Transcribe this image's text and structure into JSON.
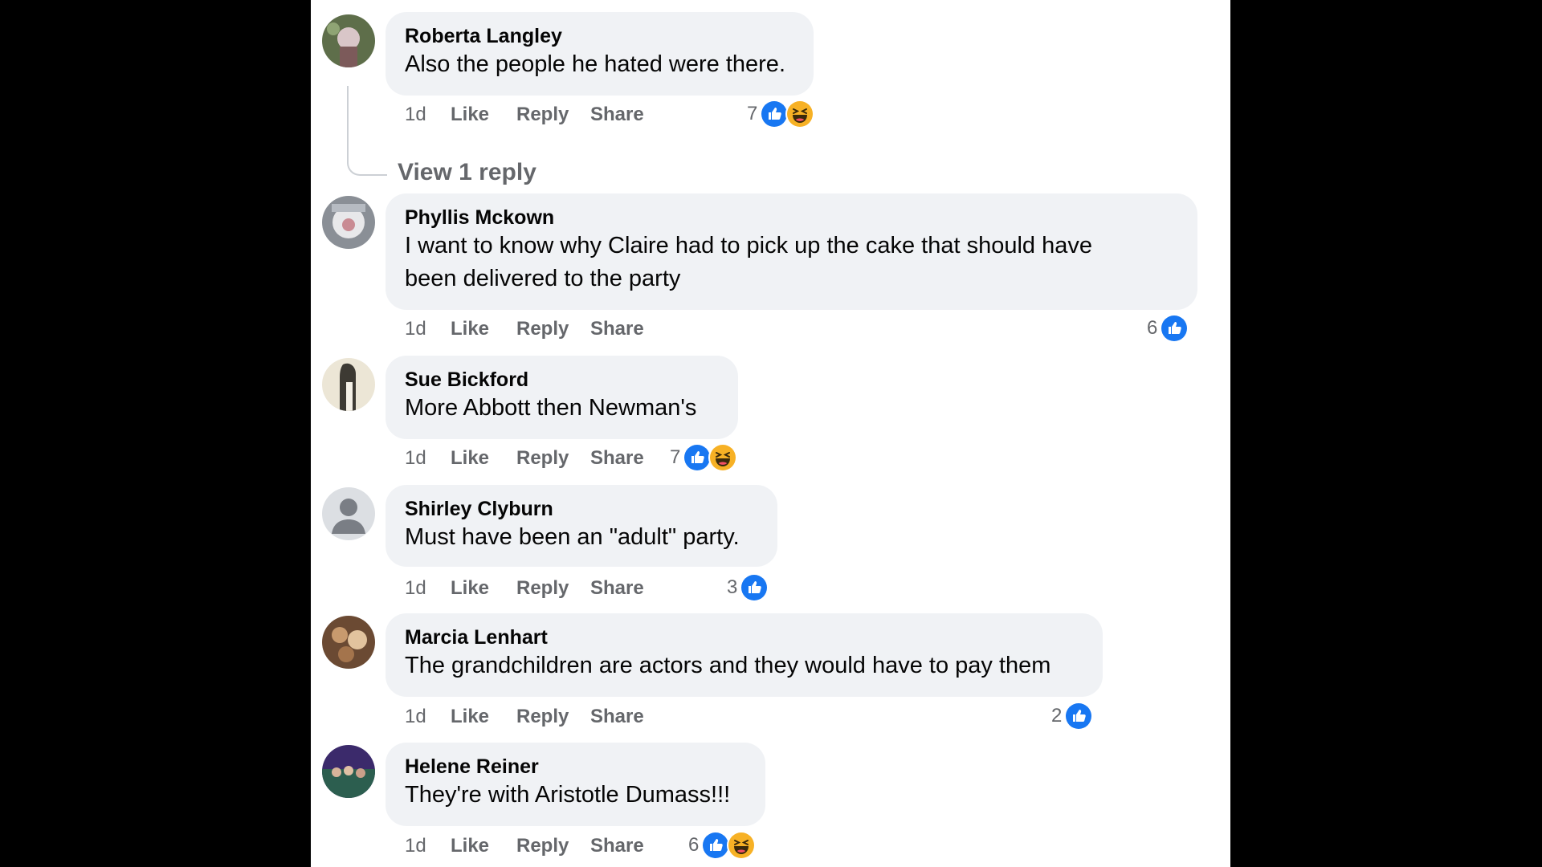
{
  "colors": {
    "like_blue": "#1877f2",
    "bubble_bg": "#f0f2f5",
    "meta_gray": "#65676b",
    "haha_yellow": "#f7b125"
  },
  "actions": {
    "time": "1d",
    "like": "Like",
    "reply": "Reply",
    "share": "Share"
  },
  "comments": [
    {
      "author": "Roberta Langley",
      "lines": [
        "Also the people he hated were there."
      ],
      "reaction_count": "7",
      "reactions": [
        "like-icon",
        "haha-icon"
      ],
      "view_replies": "View 1 reply"
    },
    {
      "author": "Phyllis Mckown",
      "lines": [
        "I want to know why Claire had to pick up the cake that should have",
        "been delivered to the party"
      ],
      "reaction_count": "6",
      "reactions": [
        "like-icon"
      ]
    },
    {
      "author": "Sue Bickford",
      "lines": [
        "More Abbott then Newman's"
      ],
      "reaction_count": "7",
      "reactions": [
        "like-icon",
        "haha-icon"
      ]
    },
    {
      "author": "Shirley Clyburn",
      "lines": [
        "Must have been an \"adult\" party."
      ],
      "reaction_count": "3",
      "reactions": [
        "like-icon"
      ]
    },
    {
      "author": "Marcia Lenhart",
      "lines": [
        "The grandchildren are actors and they would have to pay them"
      ],
      "reaction_count": "2",
      "reactions": [
        "like-icon"
      ]
    },
    {
      "author": "Helene Reiner",
      "lines": [
        "They're with Aristotle Dumass!!!"
      ],
      "reaction_count": "6",
      "reactions": [
        "like-icon",
        "haha-icon"
      ]
    }
  ]
}
